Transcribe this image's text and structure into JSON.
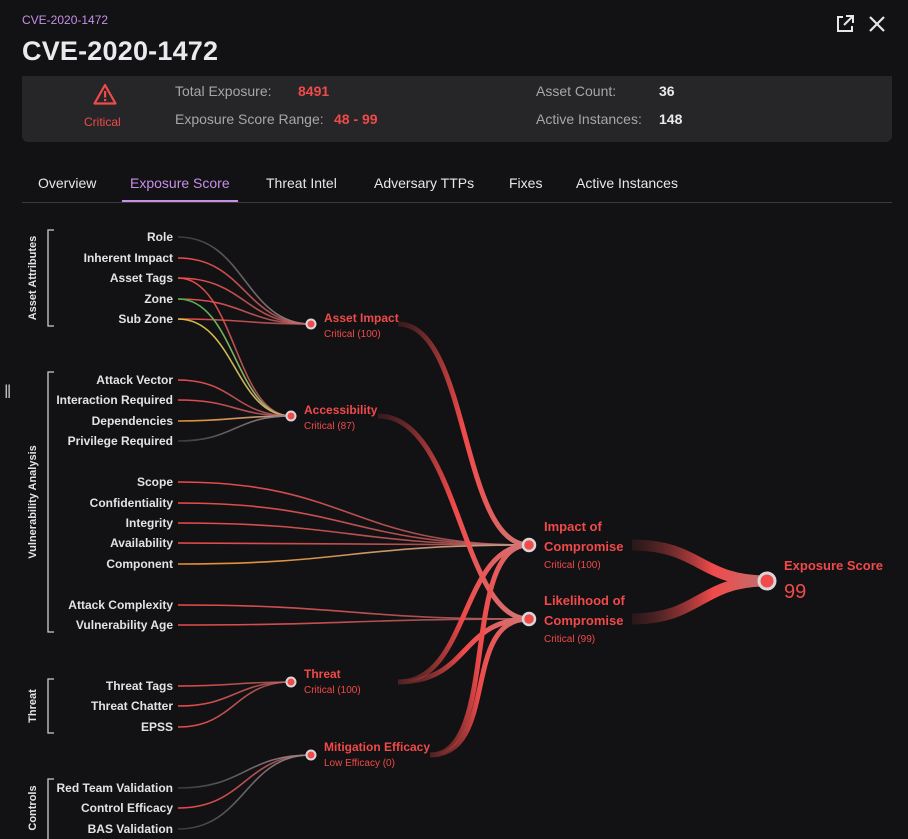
{
  "header": {
    "breadcrumb": "CVE-2020-1472",
    "title": "CVE-2020-1472"
  },
  "summary": {
    "severity": "Critical",
    "total_exposure_label": "Total Exposure:",
    "total_exposure_value": "8491",
    "score_range_label": "Exposure Score Range:",
    "score_range_value": "48 - 99",
    "asset_count_label": "Asset Count:",
    "asset_count_value": "36",
    "active_instances_label": "Active Instances:",
    "active_instances_value": "148"
  },
  "tabs": [
    {
      "label": "Overview",
      "active": false
    },
    {
      "label": "Exposure Score",
      "active": true
    },
    {
      "label": "Threat Intel",
      "active": false
    },
    {
      "label": "Adversary TTPs",
      "active": false
    },
    {
      "label": "Fixes",
      "active": false
    },
    {
      "label": "Active Instances",
      "active": false
    }
  ],
  "colors": {
    "accent": "#c790e8",
    "critical": "#f04a4a",
    "link_gray": "#8a8a8f",
    "link_green": "#3fb950",
    "link_yellow": "#d8c23a",
    "link_orange": "#e8902a"
  },
  "graph": {
    "groups": [
      {
        "label": "Asset Attributes"
      },
      {
        "label": "Vulnerability Analysis"
      },
      {
        "label": "Threat"
      },
      {
        "label": "Controls"
      }
    ],
    "factors": [
      "Role",
      "Inherent Impact",
      "Asset Tags",
      "Zone",
      "Sub Zone",
      "Attack Vector",
      "Interaction Required",
      "Dependencies",
      "Privilege Required",
      "Scope",
      "Confidentiality",
      "Integrity",
      "Availability",
      "Component",
      "Attack Complexity",
      "Vulnerability Age",
      "Threat Tags",
      "Threat Chatter",
      "EPSS",
      "Red Team Validation",
      "Control Efficacy",
      "BAS Validation"
    ],
    "intermediate": [
      {
        "name": "Asset Impact",
        "sub": "Critical (100)"
      },
      {
        "name": "Accessibility",
        "sub": "Critical (87)"
      },
      {
        "name": "Threat",
        "sub": "Critical (100)"
      },
      {
        "name": "Mitigation Efficacy",
        "sub": "Low Efficacy (0)"
      }
    ],
    "compromise": [
      {
        "name_line1": "Impact of",
        "name_line2": "Compromise",
        "sub": "Critical (100)"
      },
      {
        "name_line1": "Likelihood of",
        "name_line2": "Compromise",
        "sub": "Critical (99)"
      }
    ],
    "final": {
      "name": "Exposure Score",
      "value": "99"
    }
  }
}
